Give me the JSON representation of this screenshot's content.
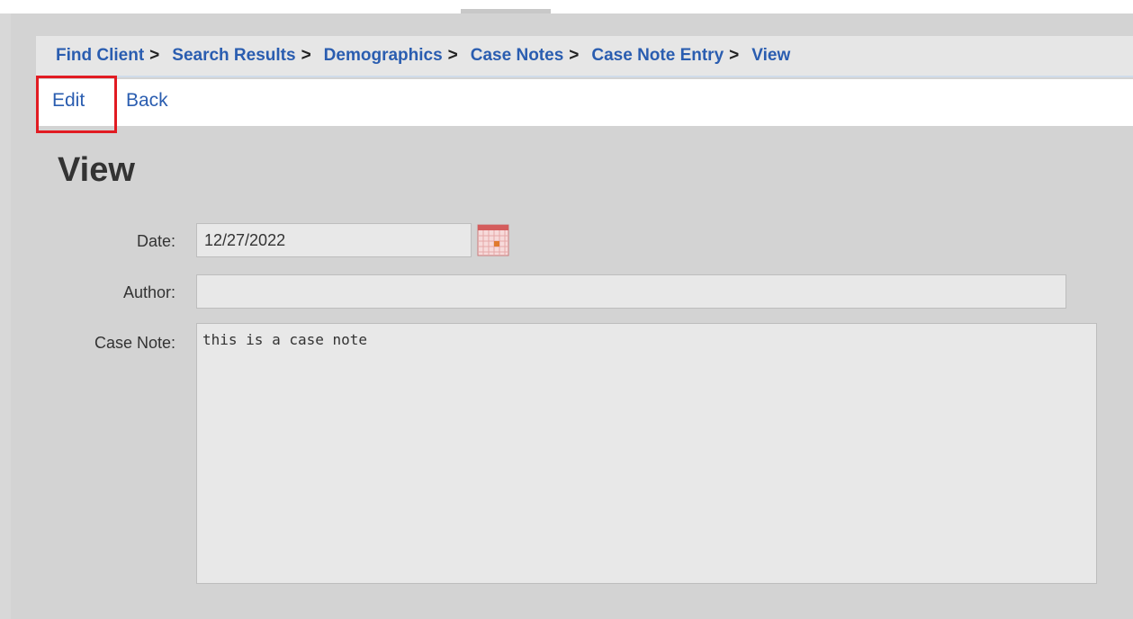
{
  "breadcrumb": {
    "items": [
      {
        "label": "Find Client"
      },
      {
        "label": "Search Results"
      },
      {
        "label": "Demographics"
      },
      {
        "label": "Case Notes"
      },
      {
        "label": "Case Note Entry"
      },
      {
        "label": "View"
      }
    ],
    "separator": ">"
  },
  "actions": {
    "edit_label": "Edit",
    "back_label": "Back"
  },
  "page": {
    "title": "View"
  },
  "form": {
    "date_label": "Date:",
    "date_value": "12/27/2022",
    "author_label": "Author:",
    "author_value": "",
    "note_label": "Case Note:",
    "note_value": "this is a case note"
  },
  "icons": {
    "calendar": "calendar-icon"
  },
  "colors": {
    "link": "#2a5db0",
    "highlight": "#e11b22",
    "panel_bg": "#d3d3d3",
    "field_bg": "#e8e8e8"
  }
}
